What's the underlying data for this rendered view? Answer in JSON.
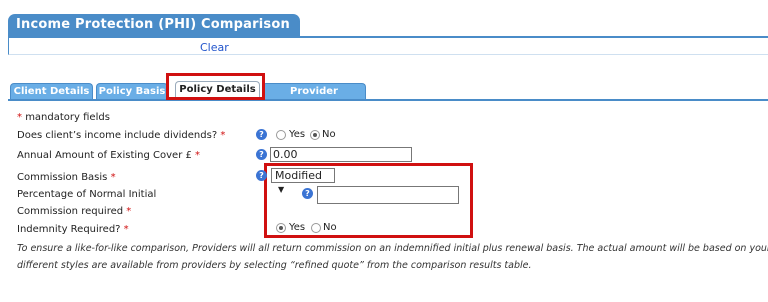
{
  "header": {
    "title": "Income Protection (PHI) Comparison Service",
    "clear_label": "Clear"
  },
  "tabs": [
    {
      "label": "Client Details"
    },
    {
      "label": "Policy Basis"
    },
    {
      "label": "Policy Details",
      "active": true
    },
    {
      "label": "Provider Selection"
    }
  ],
  "form": {
    "mandatory_text": "mandatory fields",
    "star": "*",
    "dividends_label": "Does client’s income include dividends?",
    "existing_cover_label": "Annual Amount of Existing Cover £",
    "existing_cover_value": "0.00",
    "commission_basis_label": "Commission Basis",
    "commission_basis_value": "Modified",
    "percentage_line1": "Percentage of Normal Initial",
    "percentage_line2": "Commission required",
    "percentage_value": "",
    "indemnity_label": "Indemnity Required?",
    "yes": "Yes",
    "no": "No",
    "dividends_selected": "No",
    "indemnity_selected": "Yes"
  },
  "note": {
    "line1": "To ensure a like-for-like comparison, Providers will all return commission on an indemnified initial plus renewal basis. The actual amount will be based on your spe",
    "line2": "different styles are available from providers by selecting “refined quote” from the comparison results table."
  },
  "colors": {
    "accent": "#4a8cc8",
    "highlight": "#d01010"
  },
  "icons": {
    "help": "question-icon",
    "dropdown": "triangle-down-icon"
  }
}
